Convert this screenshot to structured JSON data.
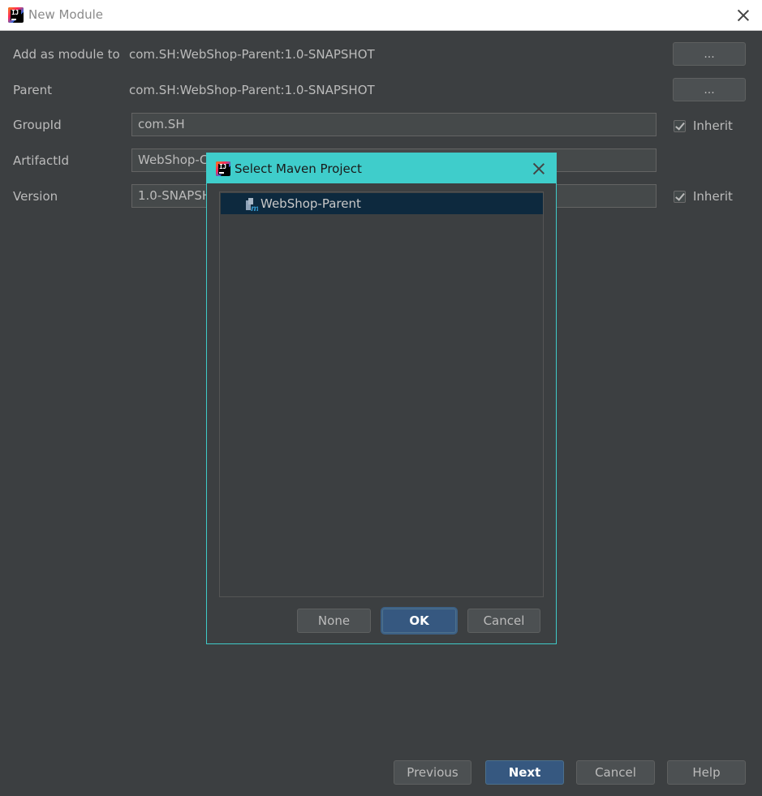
{
  "window": {
    "title": "New Module",
    "app_icon_text": "IJ"
  },
  "form": {
    "add_as_module_label": "Add as module to",
    "add_as_module_value": "com.SH:WebShop-Parent:1.0-SNAPSHOT",
    "parent_label": "Parent",
    "parent_value": "com.SH:WebShop-Parent:1.0-SNAPSHOT",
    "browse_label": "...",
    "groupid_label": "GroupId",
    "groupid_value": "com.SH",
    "artifactid_label": "ArtifactId",
    "artifactid_value": "WebShop-C",
    "version_label": "Version",
    "version_value": "1.0-SNAPSH",
    "inherit_label": "Inherit"
  },
  "footer": {
    "previous": "Previous",
    "next": "Next",
    "cancel": "Cancel",
    "help": "Help"
  },
  "modal": {
    "title": "Select Maven Project",
    "tree_items": [
      {
        "label": "WebShop-Parent",
        "icon": "maven-module-icon",
        "selected": true
      }
    ],
    "none_label": "None",
    "ok_label": "OK",
    "cancel_label": "Cancel"
  },
  "colors": {
    "background": "#3c3f41",
    "modal_title_bar": "#3fcdcb",
    "primary_button": "#365880",
    "selected_row": "#0d293e"
  }
}
